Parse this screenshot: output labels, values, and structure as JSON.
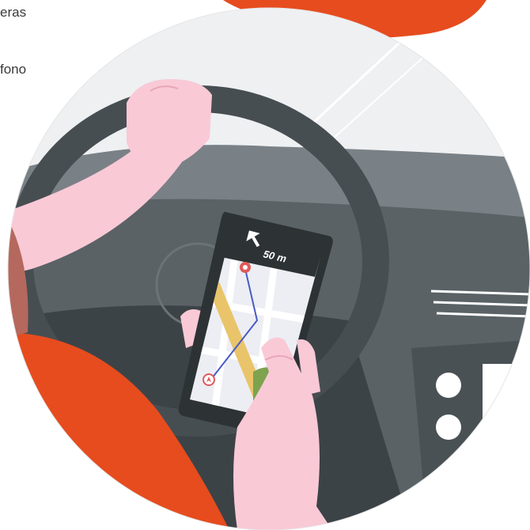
{
  "text": {
    "line1": "eras",
    "line2": "fono"
  },
  "phone": {
    "distance": "50 m",
    "turn_icon": "turn-left-arrow-icon"
  },
  "colors": {
    "accent_orange": "#e64c1e",
    "skin": "#f9c9d6",
    "dashboard": "#5a6266",
    "dashboard_dark": "#3c4347",
    "sky": "#eef0f2",
    "screen_bg": "#eceef4",
    "route_yellow": "#e9c46a",
    "route_green": "#7da34f",
    "pin_red": "#e05a5a"
  }
}
